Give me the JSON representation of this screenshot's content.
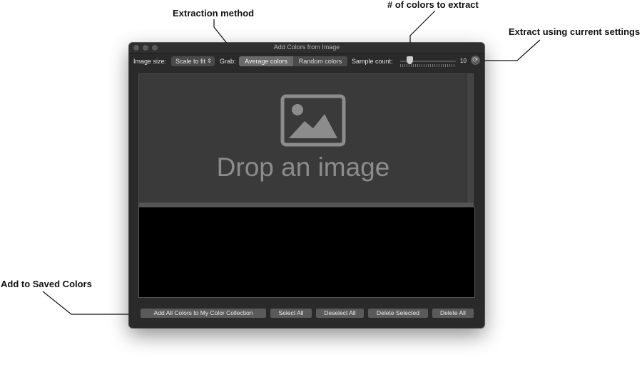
{
  "callouts": {
    "extraction_method": "Extraction method",
    "colors_to_extract": "# of colors to extract",
    "extract_current": "Extract using current settings",
    "add_saved": "Add to Saved Colors"
  },
  "window": {
    "title": "Add Colors from Image"
  },
  "toolbar": {
    "image_size_label": "Image size:",
    "image_size_value": "Scale to fit",
    "grab_label": "Grab:",
    "grab_options": [
      "Average colors",
      "Random colors"
    ],
    "grab_selected": "Average colors",
    "sample_count_label": "Sample count:",
    "sample_count_value": "10",
    "refresh_icon": "refresh-icon"
  },
  "dropzone": {
    "text": "Drop an image",
    "icon": "image-icon"
  },
  "buttons": {
    "add_all": "Add All Colors to My Color Collection",
    "select_all": "Select All",
    "deselect_all": "Deselect All",
    "delete_selected": "Delete Selected",
    "delete_all": "Delete All"
  },
  "colors": {
    "window_bg": "#2a2a2a",
    "dropzone_bg": "#3a3a3a",
    "list_bg": "#000000"
  }
}
